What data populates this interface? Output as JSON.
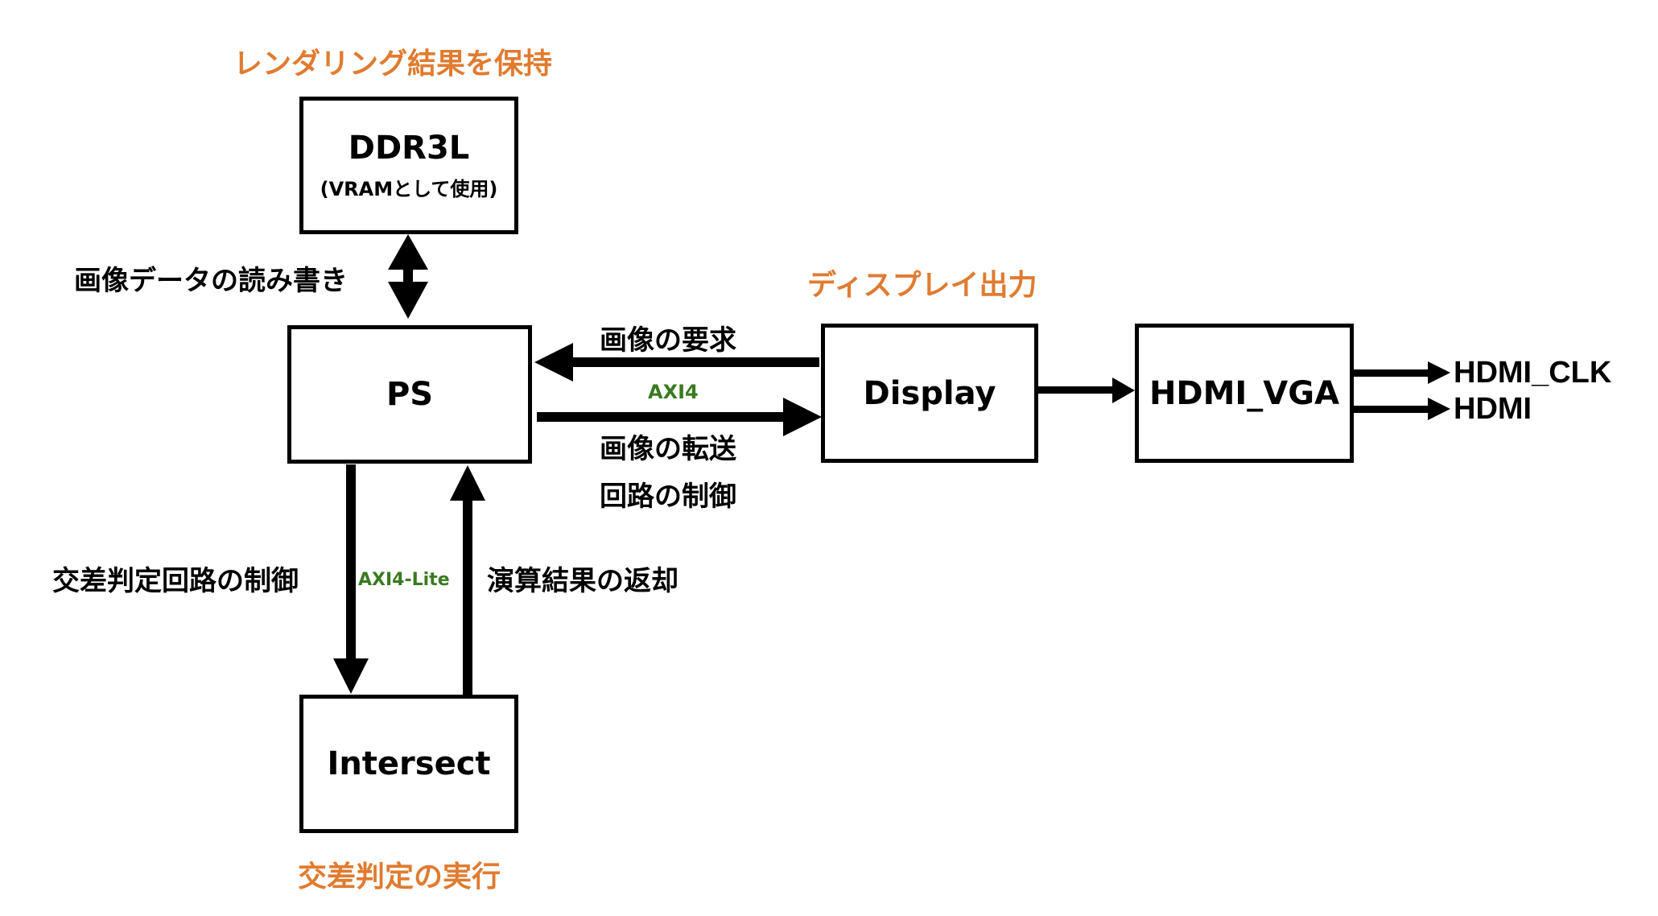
{
  "diagram": {
    "blocks": {
      "ddr3l": {
        "title": "DDR3L",
        "subtitle": "(VRAMとして使用)",
        "role": "レンダリング結果を保持"
      },
      "ps": {
        "title": "PS"
      },
      "display": {
        "title": "Display",
        "role": "ディスプレイ出力"
      },
      "hdmi_vga": {
        "title": "HDMI_VGA"
      },
      "intersect": {
        "title": "Intersect",
        "role": "交差判定の実行"
      }
    },
    "edges": {
      "ddr_ps": {
        "label": "画像データの読み書き",
        "direction": "bidirectional"
      },
      "display_to_ps": {
        "label": "画像の要求",
        "direction": "Display→PS"
      },
      "ps_to_display": {
        "label_line1": "画像の転送",
        "label_line2": "回路の制御",
        "direction": "PS→Display"
      },
      "ps_display_bus": "AXI4",
      "ps_to_intersect": {
        "label": "交差判定回路の制御",
        "direction": "PS→Intersect"
      },
      "intersect_to_ps": {
        "label": "演算結果の返却",
        "direction": "Intersect→PS"
      },
      "ps_intersect_bus": "AXI4-Lite",
      "display_to_hdmi": {
        "direction": "Display→HDMI_VGA"
      },
      "outputs": [
        "HDMI_CLK",
        "HDMI"
      ]
    },
    "colors": {
      "role_label": "#e07b30",
      "bus_label": "#3a7a20",
      "stroke": "#000000"
    }
  }
}
